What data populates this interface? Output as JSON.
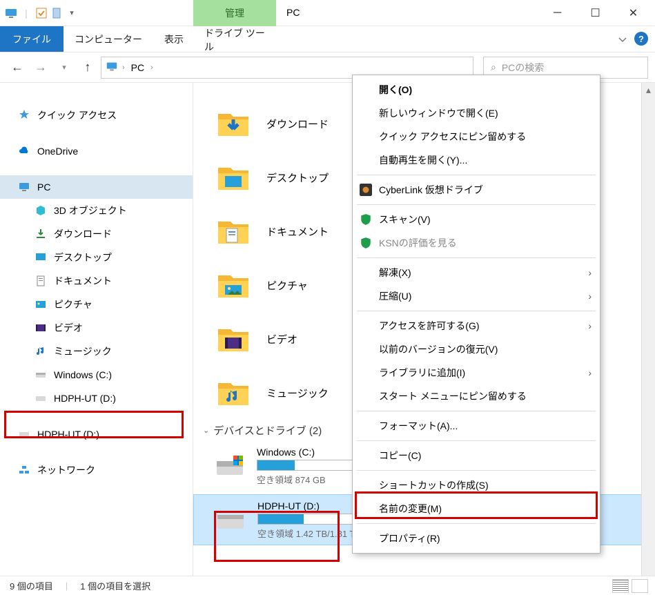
{
  "window": {
    "title": "PC",
    "mgmt_tab": "管理",
    "ribbon": {
      "file": "ファイル",
      "computer": "コンピューター",
      "view": "表示",
      "drive_tools": "ドライブ ツール"
    }
  },
  "address": {
    "root": "PC"
  },
  "search": {
    "placeholder": "PCの検索"
  },
  "nav": {
    "quick_access": "クイック アクセス",
    "onedrive": "OneDrive",
    "pc": "PC",
    "objects3d": "3D オブジェクト",
    "downloads": "ダウンロード",
    "desktop": "デスクトップ",
    "documents": "ドキュメント",
    "pictures": "ピクチャ",
    "videos": "ビデオ",
    "music": "ミュージック",
    "drive_c": "Windows (C:)",
    "drive_d": "HDPH-UT (D:)",
    "drive_d2": "HDPH-UT (D:)",
    "network": "ネットワーク"
  },
  "folders": {
    "downloads": "ダウンロード",
    "desktop": "デスクトップ",
    "documents": "ドキュメント",
    "pictures": "ピクチャ",
    "videos": "ビデオ",
    "music": "ミュージック"
  },
  "devices": {
    "header": "デバイスとドライブ (2)",
    "c": {
      "name": "Windows (C:)",
      "free": "空き領域 874 GB",
      "fill_pct": 18
    },
    "d": {
      "name": "HDPH-UT (D:)",
      "free": "空き領域 1.42 TB/1.81 TB",
      "fill_pct": 22
    }
  },
  "status": {
    "items": "9 個の項目",
    "selected": "1 個の項目を選択"
  },
  "ctx": {
    "open": "開く(O)",
    "open_new": "新しいウィンドウで開く(E)",
    "pin_quick": "クイック アクセスにピン留めする",
    "autoplay": "自動再生を開く(Y)...",
    "cyberlink": "CyberLink 仮想ドライブ",
    "scan": "スキャン(V)",
    "ksn": "KSNの評価を見る",
    "extract": "解凍(X)",
    "compress": "圧縮(U)",
    "grant": "アクセスを許可する(G)",
    "prev_ver": "以前のバージョンの復元(V)",
    "add_lib": "ライブラリに追加(I)",
    "pin_start": "スタート メニューにピン留めする",
    "format": "フォーマット(A)...",
    "copy": "コピー(C)",
    "shortcut": "ショートカットの作成(S)",
    "rename": "名前の変更(M)",
    "properties": "プロパティ(R)"
  }
}
